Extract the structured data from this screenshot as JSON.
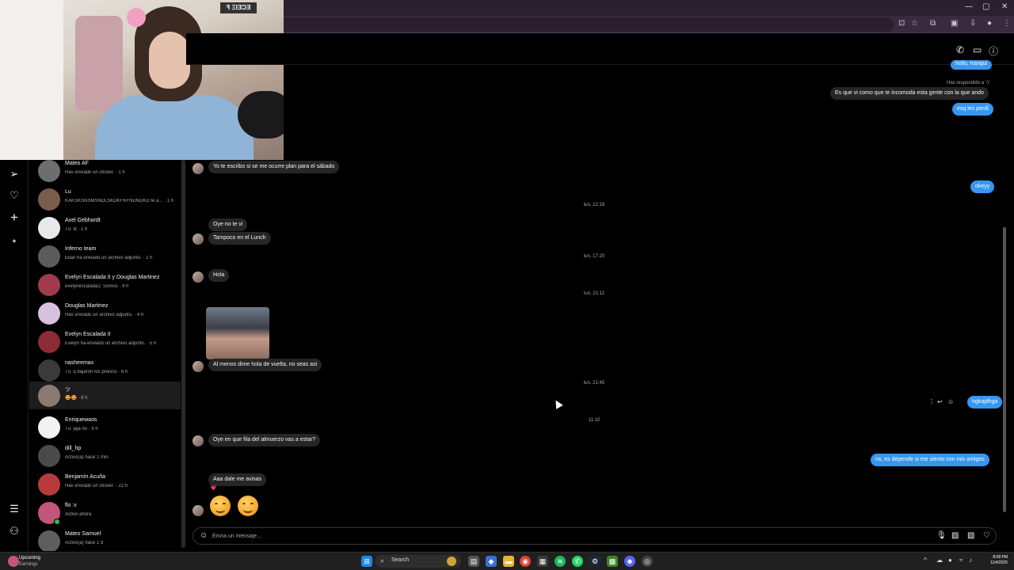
{
  "webcam": {
    "sign_text": "ꟻ ΞIƎƆƎ"
  },
  "browser": {
    "window_controls": [
      "—",
      "▢",
      "✕"
    ]
  },
  "rail": {
    "icons": [
      "send-icon",
      "heart-icon",
      "plus-icon",
      "profile-icon",
      "menu-icon",
      "apps-icon"
    ]
  },
  "conversations": [
    {
      "name": "Mateo AF",
      "sub": "Has enviado un sticker. · 1 h",
      "color": "#6e6e6e"
    },
    {
      "name": "Lu",
      "sub": "KAKSKSNSMSNDLSKDKFKFNDNDKD te a... · 1 h",
      "color": "#7a5c4d"
    },
    {
      "name": "Axel Gebhardt",
      "sub": "Tú: lit · 1 h",
      "color": "#e9e9e9"
    },
    {
      "name": "Inferno team",
      "sub": "Elian ha enviado un archivo adjunto. · 2 h",
      "color": "#5b5b5b"
    },
    {
      "name": "Evelyn Escalada II y Douglas Martinez",
      "sub": "evelynescalada1: Somos · 4 h",
      "color": "#a23a4e"
    },
    {
      "name": "Douglas Martinez",
      "sub": "Has enviado un archivo adjunto. · 4 h",
      "color": "#d6c2e0"
    },
    {
      "name": "Evelyn Escalada II",
      "sub": "Evelyn ha enviado un archivo adjunto. · 5 h",
      "color": "#8c2b35"
    },
    {
      "name": "nasheemax",
      "sub": "Tú: q bajaron los precios · 6 h",
      "color": "#3a3a3a"
    },
    {
      "name": "ツ",
      "sub": "🤩🤩 · 8 h",
      "color": "#8a7a72",
      "active": true
    },
    {
      "name": "Enriquewaos",
      "sub": "Tú: jaja no · 9 h",
      "color": "#f2f2f2"
    },
    {
      "name": "dill_hp",
      "sub": "Activo(a) hace 1 min",
      "color": "#4a4a4a"
    },
    {
      "name": "Benjamín Acuña",
      "sub": "Has enviado un sticker. · 22 h",
      "color": "#b83a3a"
    },
    {
      "name": "flo :v",
      "sub": "Activo ahora",
      "color": "#c2557a",
      "online": true
    },
    {
      "name": "Mateo Samuel",
      "sub": "Activo(a) hace 1 d",
      "color": "#5e5e5e"
    }
  ],
  "chat": {
    "top_partial_out": "hollo, tranqui",
    "reply_note": "Has respondido a ツ",
    "reply_quote": "Es que vi como que te incomoda esta gente con la que ando",
    "out_1": "esq les perdí",
    "out_2": "okeyy",
    "in_0": "Yo te escribo si se me ocurre plan para el sábado",
    "sep_1": "lun, 12:18",
    "in_1": "Oye no te vi",
    "in_2": "Tampoco en el Lunch",
    "sep_2": "lun, 17:20",
    "in_3": "Hola",
    "sep_3": "lun, 21:11",
    "in_4": "Al menos dime hola de vuelta, no seas asi",
    "sep_4": "lun, 21:45",
    "out_3": "hgkajdhga",
    "sep_5": "11:10",
    "in_5": "Oye en que fila del almuerzo vas a estar?",
    "out_4": "ns, es depende si me siento con mis amigos",
    "in_6": "Aaa dale me avisas",
    "reaction": "💗"
  },
  "composer": {
    "placeholder": "Envía un mensaje..."
  },
  "taskbar": {
    "upcoming_title": "Upcoming",
    "upcoming_sub": "Earnings",
    "search_label": "Search",
    "time": "8:08 PM",
    "date": "11/4/2025"
  }
}
